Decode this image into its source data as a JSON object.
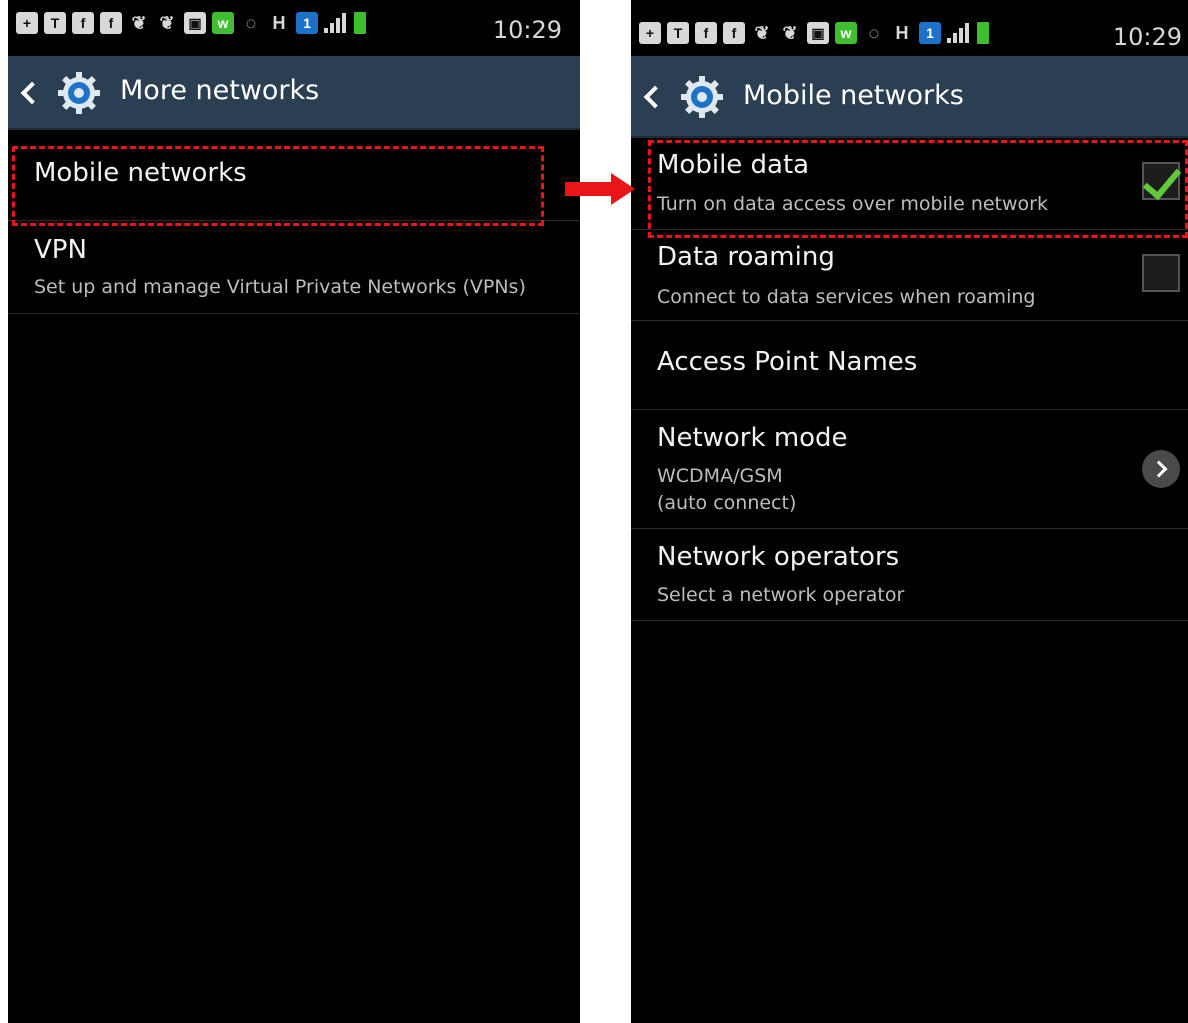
{
  "status_bar": {
    "time": "10:29",
    "icons": [
      "plus-icon",
      "t-icon",
      "facebook-icon",
      "facebook-icon",
      "twitter-icon",
      "twitter-icon",
      "blackberry-icon",
      "w-icon",
      "eye-icon",
      "h-network-icon",
      "sim-1-icon",
      "signal-icon",
      "battery-icon"
    ],
    "icon_glyphs": [
      "+",
      "T",
      "f",
      "f",
      "❦",
      "❦",
      "▣",
      "w",
      "◌",
      "H",
      "1"
    ]
  },
  "left_screen": {
    "title": "More networks",
    "items": [
      {
        "label": "Mobile networks"
      },
      {
        "label": "VPN",
        "summary": "Set up and manage Virtual Private Networks (VPNs)"
      }
    ]
  },
  "right_screen": {
    "title": "Mobile networks",
    "items": [
      {
        "label": "Mobile data",
        "summary": "Turn on data access over mobile network",
        "checked": true
      },
      {
        "label": "Data roaming",
        "summary": "Connect to data services when roaming",
        "checked": false
      },
      {
        "label": "Access Point Names"
      },
      {
        "label": "Network mode",
        "summary_line1": "WCDMA/GSM",
        "summary_line2": "(auto connect)"
      },
      {
        "label": "Network operators",
        "summary": "Select a network operator"
      }
    ]
  },
  "colors": {
    "action_bar": "#2b3f52",
    "highlight": "#e8151b",
    "check": "#62c93a"
  }
}
